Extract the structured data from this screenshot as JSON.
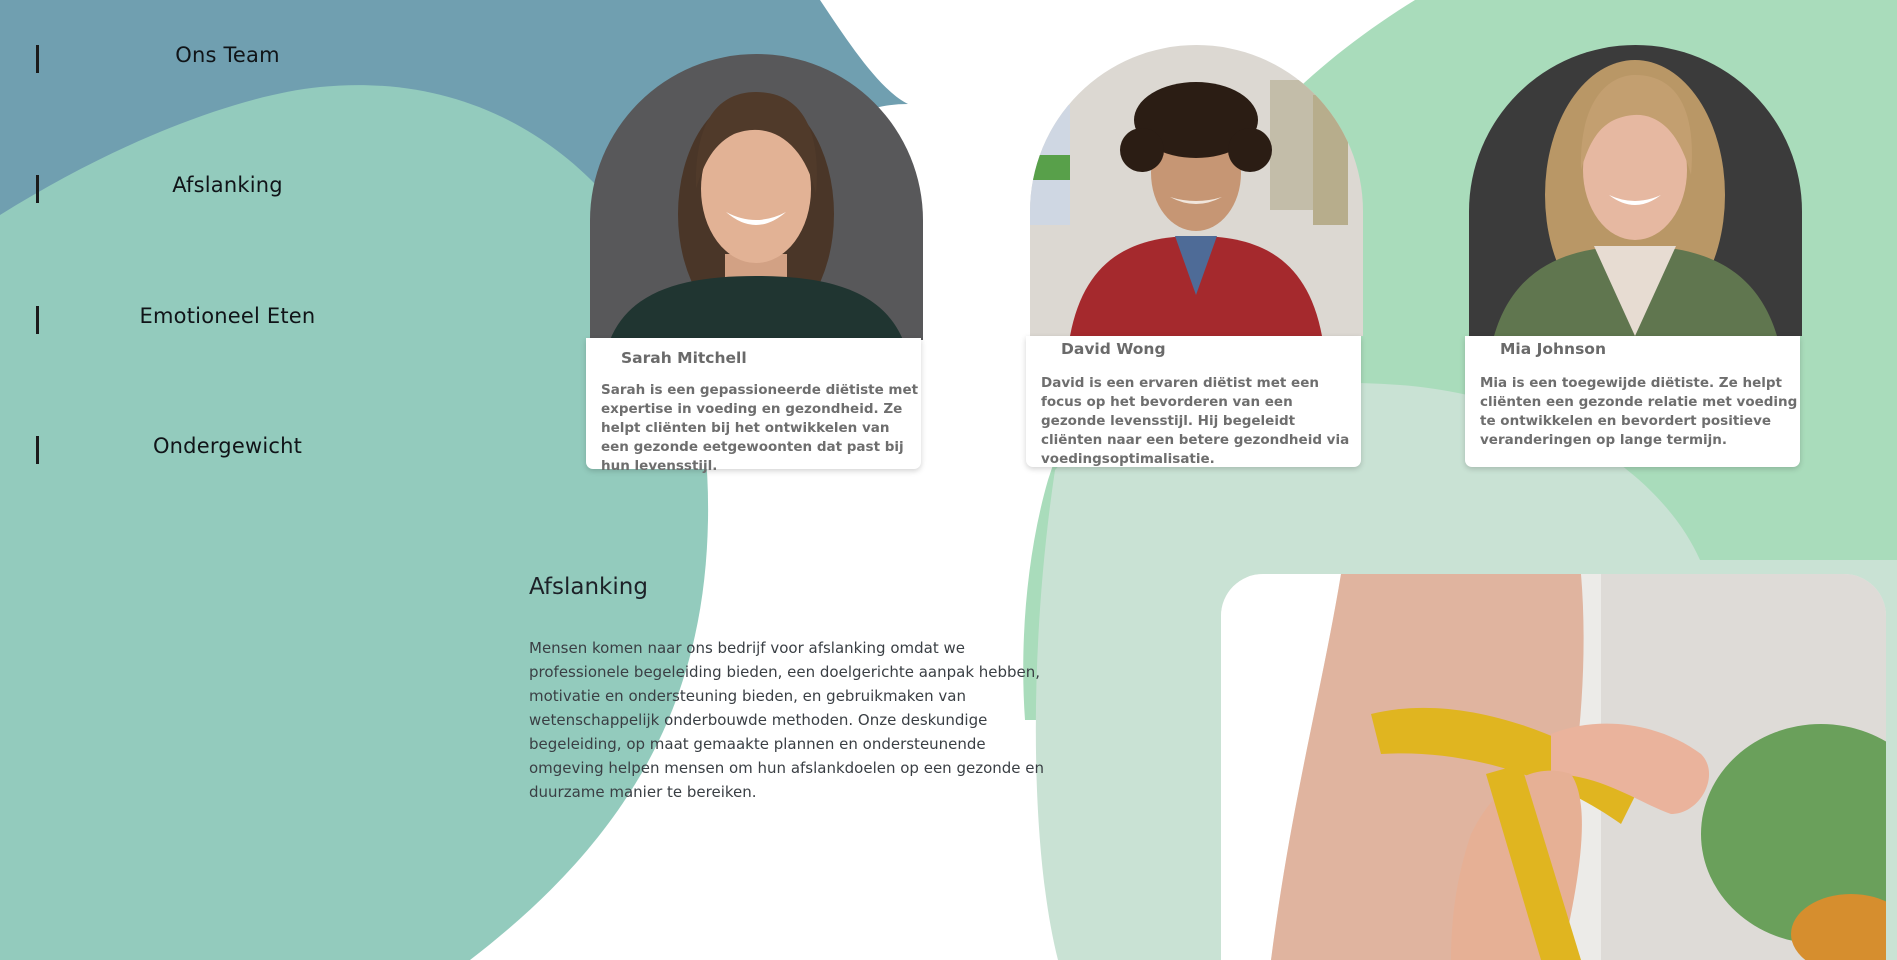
{
  "nav": {
    "items": [
      {
        "label": "Ons Team"
      },
      {
        "label": "Afslanking"
      },
      {
        "label": "Emotioneel Eten"
      },
      {
        "label": "Ondergewicht"
      }
    ]
  },
  "team": {
    "members": [
      {
        "name": "Sarah Mitchell",
        "bio": "Sarah is een gepassioneerde diëtiste met expertise in voeding en gezondheid. Ze helpt cliënten bij het ontwikkelen van een gezonde eetgewoonten dat past bij hun levensstijl."
      },
      {
        "name": "David Wong",
        "bio": "David is een ervaren diëtist met een focus op het bevorderen van een gezonde levensstijl. Hij begeleidt cliënten naar een betere gezondheid via voedingsoptimalisatie."
      },
      {
        "name": "Mia Johnson",
        "bio": "Mia is een toegewijde diëtiste. Ze helpt cliënten een gezonde relatie met voeding te ontwikkelen en bevordert positieve veranderingen op lange termijn."
      }
    ]
  },
  "section": {
    "title": "Afslanking",
    "text": "Mensen komen naar ons bedrijf voor afslanking omdat we professionele begeleiding bieden, een doelgerichte aanpak hebben, motivatie en ondersteuning bieden, en gebruikmaken van wetenschappelijk onderbouwde methoden. Onze deskundige begeleiding, op maat gemaakte plannen en ondersteunende omgeving helpen mensen om hun afslankdoelen op een gezonde en duurzame manier te bereiken."
  },
  "colors": {
    "steel_blue": "#709fb0",
    "teal": "#93cbbd",
    "mint": "#a9dcbb",
    "pale_mint": "#c9e2d4",
    "text_dark": "#101418"
  }
}
